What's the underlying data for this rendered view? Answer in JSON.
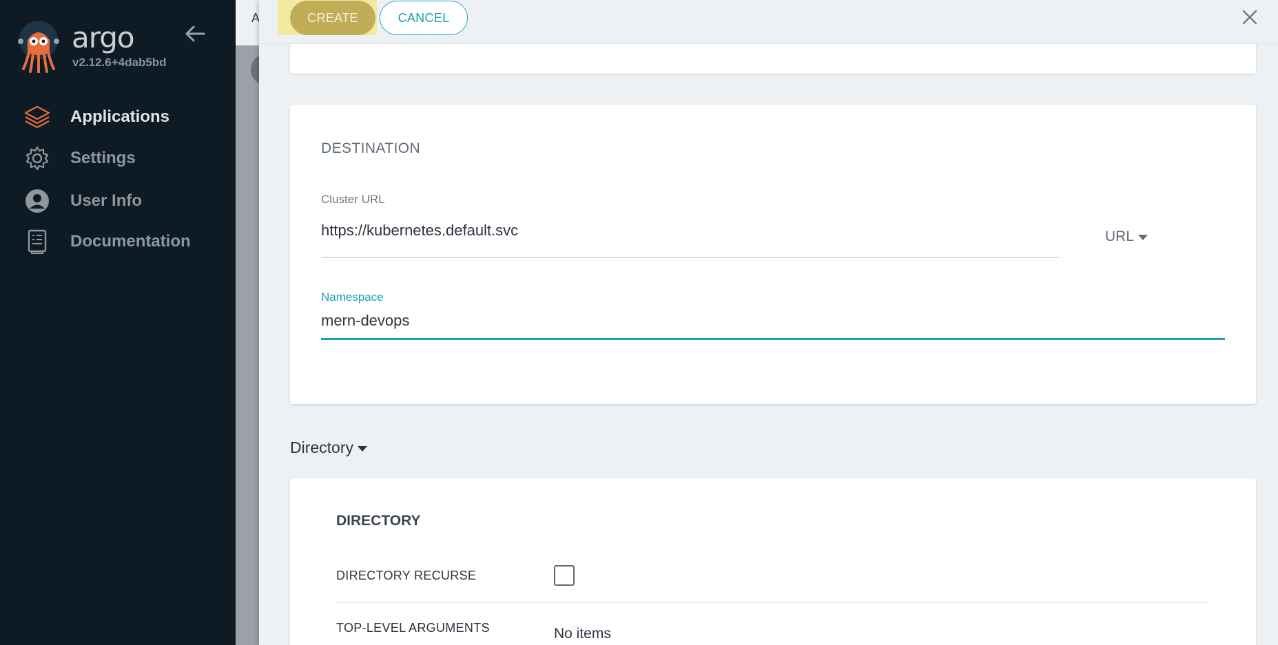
{
  "sidebar": {
    "brand": "argo",
    "version": "v2.12.6+4dab5bd",
    "items": [
      {
        "label": "Applications",
        "icon": "layers-icon",
        "active": true
      },
      {
        "label": "Settings",
        "icon": "gear-icon",
        "active": false
      },
      {
        "label": "User Info",
        "icon": "user-icon",
        "active": false
      },
      {
        "label": "Documentation",
        "icon": "book-icon",
        "active": false
      }
    ]
  },
  "background": {
    "header_letter": "A"
  },
  "panel": {
    "create_label": "CREATE",
    "cancel_label": "CANCEL",
    "destination": {
      "title": "DESTINATION",
      "cluster_url_label": "Cluster URL",
      "cluster_url_value": "https://kubernetes.default.svc",
      "url_type": "URL",
      "namespace_label": "Namespace",
      "namespace_value": "mern-devops"
    },
    "source_type": "Directory",
    "directory": {
      "title": "DIRECTORY",
      "recurse_label": "DIRECTORY RECURSE",
      "recurse_checked": false,
      "top_level_args_label": "TOP-LEVEL ARGUMENTS",
      "top_level_args_value": "No items"
    }
  },
  "colors": {
    "sidebar_bg": "#0e1b25",
    "accent": "#16a3b6",
    "create_button": "#bfae57",
    "argo_orange": "#e96d3c"
  }
}
